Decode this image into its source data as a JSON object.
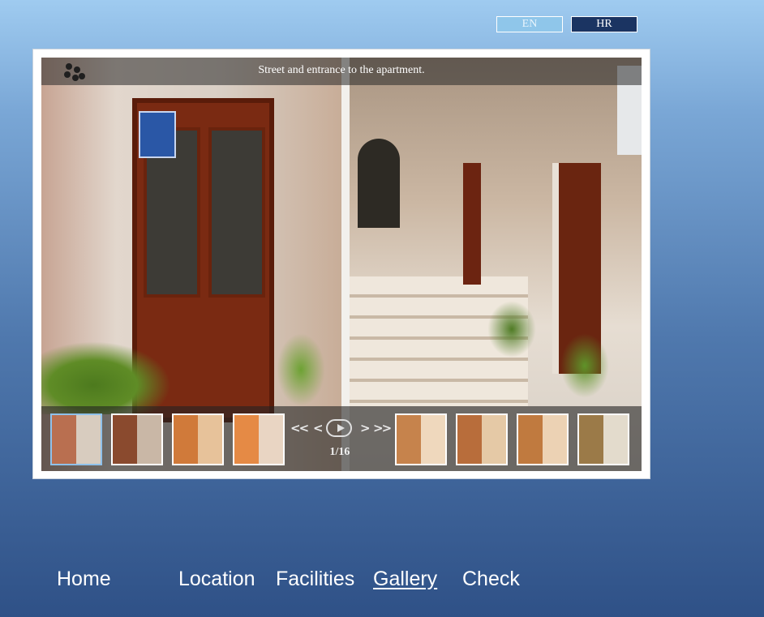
{
  "language": {
    "en_label": "EN",
    "hr_label": "HR",
    "selected": "HR"
  },
  "gallery": {
    "caption": "Street and entrance to the apartment.",
    "counter": "1/16",
    "controls": {
      "first": "<<",
      "prev": "<",
      "play": "play",
      "next": ">",
      "last": ">>"
    },
    "thumbnails": [
      {
        "alt": "street-entrance",
        "active": true,
        "c1": "#b96f50",
        "c2": "#d8ccbf"
      },
      {
        "alt": "stone-lane",
        "active": false,
        "c1": "#8a4a2e",
        "c2": "#c9b7a6"
      },
      {
        "alt": "living-room-sofa",
        "active": false,
        "c1": "#d07a3a",
        "c2": "#e7c29a"
      },
      {
        "alt": "orange-sofa-corner",
        "active": false,
        "c1": "#e58a45",
        "c2": "#e9d5c3"
      },
      {
        "alt": "bedroom-double",
        "active": false,
        "c1": "#c6834c",
        "c2": "#efd8bd"
      },
      {
        "alt": "bedroom-twin",
        "active": false,
        "c1": "#b86d3b",
        "c2": "#e5c9a6"
      },
      {
        "alt": "bedroom-window",
        "active": false,
        "c1": "#c07a3f",
        "c2": "#ecd2b4"
      },
      {
        "alt": "hallway-plant",
        "active": false,
        "c1": "#9b7a48",
        "c2": "#e3dbcc"
      }
    ]
  },
  "nav": {
    "items": [
      {
        "label": "Home",
        "current": false
      },
      {
        "label": "Location",
        "current": false
      },
      {
        "label": "Facilities",
        "current": false
      },
      {
        "label": "Gallery",
        "current": true
      },
      {
        "label": "Check",
        "current": false
      }
    ]
  },
  "colors": {
    "selected_lang_bg": "#1b3462",
    "unselected_lang_bg": "#8fc6ea",
    "active_thumb_border": "#8fc1ea"
  }
}
